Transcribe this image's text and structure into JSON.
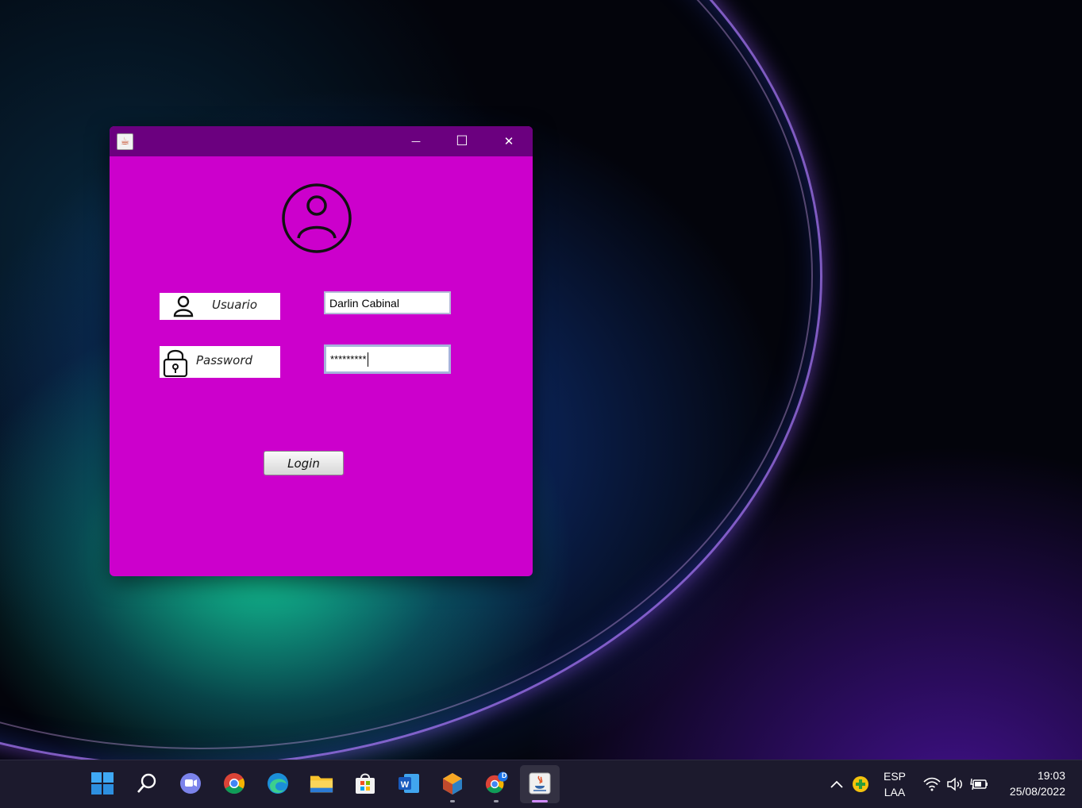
{
  "window": {
    "title_icon": "java-cup-icon",
    "controls": {
      "minimize": "—",
      "maximize": "☐",
      "close": "✕"
    }
  },
  "form": {
    "usuario_label": "Usuario",
    "password_label": "Password",
    "usuario_value": "Darlin Cabinal",
    "password_value": "*********",
    "login_label": "Login"
  },
  "colors": {
    "window_bg": "#cc00cc",
    "titlebar_bg": "#6b007f"
  },
  "taskbar": {
    "apps": [
      "start-icon",
      "search-icon",
      "teams-chat-icon",
      "chrome-icon",
      "edge-icon",
      "file-explorer-icon",
      "microsoft-store-icon",
      "word-icon",
      "netbeans-icon",
      "chrome-profile-icon",
      "java-app-icon"
    ],
    "chrome_profile_badge": "D",
    "language_top": "ESP",
    "language_bottom": "LAA",
    "time": "19:03",
    "date": "25/08/2022"
  }
}
